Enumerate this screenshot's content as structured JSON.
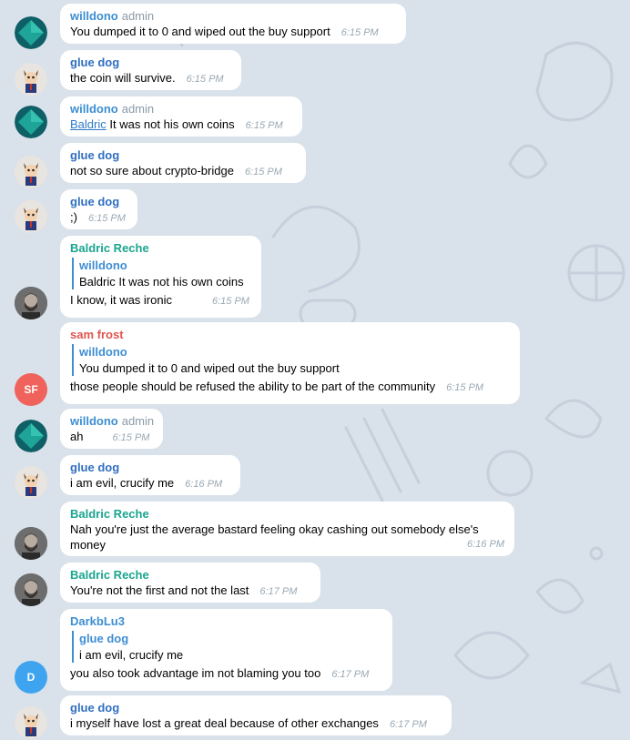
{
  "colors": {
    "background": "#d9e1ea",
    "bubble": "#ffffff",
    "name_willdono": "#3c8fd2",
    "name_gluedog": "#2f6fc0",
    "name_baldric": "#1aa58f",
    "name_samfrost": "#e0544e",
    "name_darkblu": "#3c8fd2",
    "role": "#8c9aa6",
    "time": "#9aa8b3",
    "quote_bar": "#3f8ed4"
  },
  "messages": [
    {
      "sender": "willdono",
      "role": "admin",
      "text": "You dumped it to 0 and wiped out the buy support",
      "time": "6:15 PM",
      "avatar": "diamond-icon"
    },
    {
      "sender": "glue dog",
      "text": "the coin will survive.",
      "time": "6:15 PM",
      "avatar": "dog-avatar"
    },
    {
      "sender": "willdono",
      "role": "admin",
      "mention": "Baldric",
      "text": " It was not his own coins",
      "time": "6:15 PM",
      "avatar": "diamond-icon"
    },
    {
      "sender": "glue dog",
      "text": "not so sure about crypto-bridge",
      "time": "6:15 PM",
      "avatar": "dog-avatar"
    },
    {
      "sender": "glue dog",
      "text": ";)",
      "time": "6:15 PM",
      "avatar": "dog-avatar"
    },
    {
      "sender": "Baldric Reche",
      "quote_name": "willdono",
      "quote_text": "Baldric It was not his own coins",
      "text": "I know, it was ironic",
      "time": "6:15 PM",
      "avatar": "bearded-man-photo"
    },
    {
      "sender": "sam frost",
      "quote_name": "willdono",
      "quote_text": "You dumped it to 0 and wiped out the buy support",
      "text": "those people should be refused the ability to be part of the community",
      "time": "6:15 PM",
      "avatar_initials": "SF"
    },
    {
      "sender": "willdono",
      "role": "admin",
      "text": "ah",
      "time": "6:15 PM",
      "avatar": "diamond-icon"
    },
    {
      "sender": "glue dog",
      "text": "i am evil, crucify me",
      "time": "6:16 PM",
      "avatar": "dog-avatar"
    },
    {
      "sender": "Baldric Reche",
      "text": "Nah you're just the average bastard feeling okay cashing out somebody else's",
      "text2": "money",
      "time": "6:16 PM",
      "avatar": "bearded-man-photo"
    },
    {
      "sender": "Baldric Reche",
      "text": "You're not the first and not the last",
      "time": "6:17 PM",
      "avatar": "bearded-man-photo"
    },
    {
      "sender": "DarkbLu3",
      "quote_name": "glue dog",
      "quote_text": "i am evil, crucify me",
      "text": "you also took advantage im not blaming you too",
      "time": "6:17 PM",
      "avatar_initials": "D"
    },
    {
      "sender": "glue dog",
      "text": "i myself have lost a great deal because of other exchanges",
      "time": "6:17 PM",
      "avatar": "dog-avatar"
    }
  ]
}
